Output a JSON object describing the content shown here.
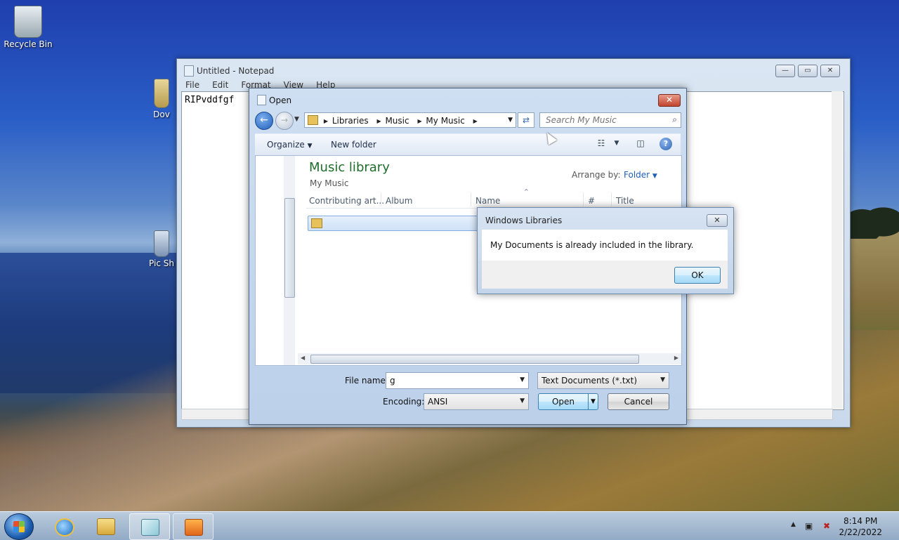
{
  "desktop": {
    "icons": [
      {
        "label": "Recycle Bin"
      },
      {
        "label": "Dov"
      },
      {
        "label": "Pic Sh"
      }
    ]
  },
  "notepad": {
    "title": "Untitled - Notepad",
    "menu": [
      "File",
      "Edit",
      "Format",
      "View",
      "Help"
    ],
    "content": "RIPvddfgf",
    "buttons": {
      "minimize": "—",
      "maximize": "▭",
      "close": "✕"
    }
  },
  "open_dialog": {
    "title": "Open",
    "breadcrumb": [
      "Libraries",
      "Music",
      "My Music"
    ],
    "search_placeholder": "Search My Music",
    "toolbar": {
      "organize": "Organize",
      "new_folder": "New folder"
    },
    "library_title": "Music library",
    "library_subtitle": "My Music",
    "arrange_label": "Arrange by:",
    "arrange_value": "Folder",
    "columns": [
      "Contributing art...",
      "Album",
      "Name",
      "#",
      "Title"
    ],
    "file_name_label": "File name:",
    "file_name_value": "g",
    "file_type": "Text Documents (*.txt)",
    "encoding_label": "Encoding:",
    "encoding_value": "ANSI",
    "open_button": "Open",
    "cancel_button": "Cancel"
  },
  "message": {
    "title": "Windows Libraries",
    "text": "My Documents is already included in the library.",
    "ok_button": "OK"
  },
  "taskbar": {
    "time": "8:14 PM",
    "date": "2/22/2022"
  },
  "colors": {
    "accent": "#1e5fb8",
    "library_title": "#1e6e2a"
  }
}
